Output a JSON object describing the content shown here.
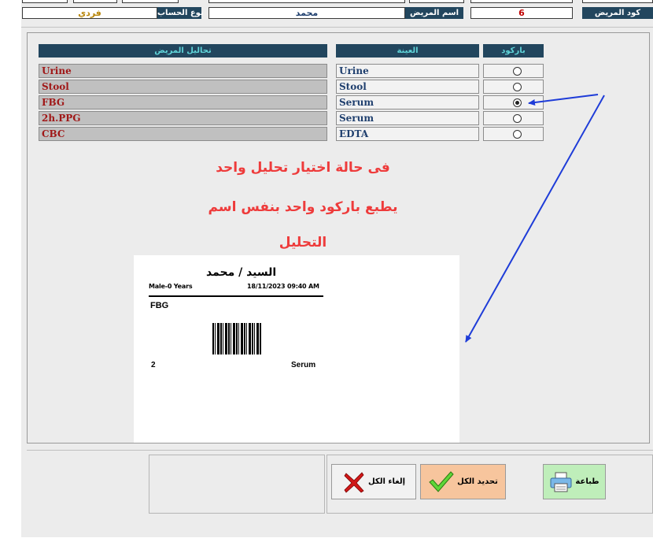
{
  "header": {
    "account_type_label": "نوع الحساب",
    "account_type_value": "فردي",
    "patient_name_label": "اسم المريض",
    "patient_name_value": "محمد",
    "patient_code_label": "كود المريض",
    "patient_code_value": "6"
  },
  "table": {
    "tests_header": "تحاليل المريض",
    "sample_header": "العينة",
    "barcode_header": "باركود",
    "rows": [
      {
        "test": "Urine",
        "sample": "Urine",
        "selected": false
      },
      {
        "test": "Stool",
        "sample": "Stool",
        "selected": false
      },
      {
        "test": "FBG",
        "sample": "Serum",
        "selected": true
      },
      {
        "test": "2h.PPG",
        "sample": "Serum",
        "selected": false
      },
      {
        "test": "CBC",
        "sample": "EDTA",
        "selected": false
      }
    ]
  },
  "annotation": {
    "line1": "فى حالة اختيار تحليل واحد",
    "line2": "يطبع باركود واحد بنفس اسم",
    "line3": "التحليل",
    "color": "#ee3b3b",
    "arrow_color": "#1e3cd8"
  },
  "label_preview": {
    "title": "السيد / محمد",
    "meta": "Male-0 Years",
    "datetime": "18/11/2023 09:40 AM",
    "test": "FBG",
    "number": "2",
    "sample": "Serum"
  },
  "buttons": {
    "clear_all": "إلغاء الكل",
    "select_all": "تحديد الكل",
    "print": "طباعة"
  }
}
